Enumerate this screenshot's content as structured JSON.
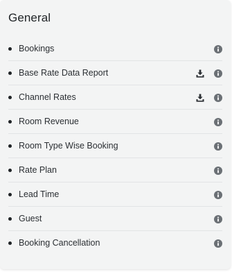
{
  "panel": {
    "title": "General"
  },
  "icons": {
    "info": "info-circle-icon",
    "download": "download-icon",
    "bullet": "bullet-dot"
  },
  "colors": {
    "panel_background": "#f3f4f4",
    "text": "#2b2f33",
    "icon": "#6b7075",
    "download_icon": "#2b2f33"
  },
  "reports": [
    {
      "label": "Bookings",
      "downloadable": false
    },
    {
      "label": "Base Rate Data Report",
      "downloadable": true
    },
    {
      "label": "Channel Rates",
      "downloadable": true
    },
    {
      "label": "Room Revenue",
      "downloadable": false
    },
    {
      "label": "Room Type Wise Booking",
      "downloadable": false
    },
    {
      "label": "Rate Plan",
      "downloadable": false
    },
    {
      "label": "Lead Time",
      "downloadable": false
    },
    {
      "label": "Guest",
      "downloadable": false
    },
    {
      "label": "Booking Cancellation",
      "downloadable": false
    }
  ]
}
